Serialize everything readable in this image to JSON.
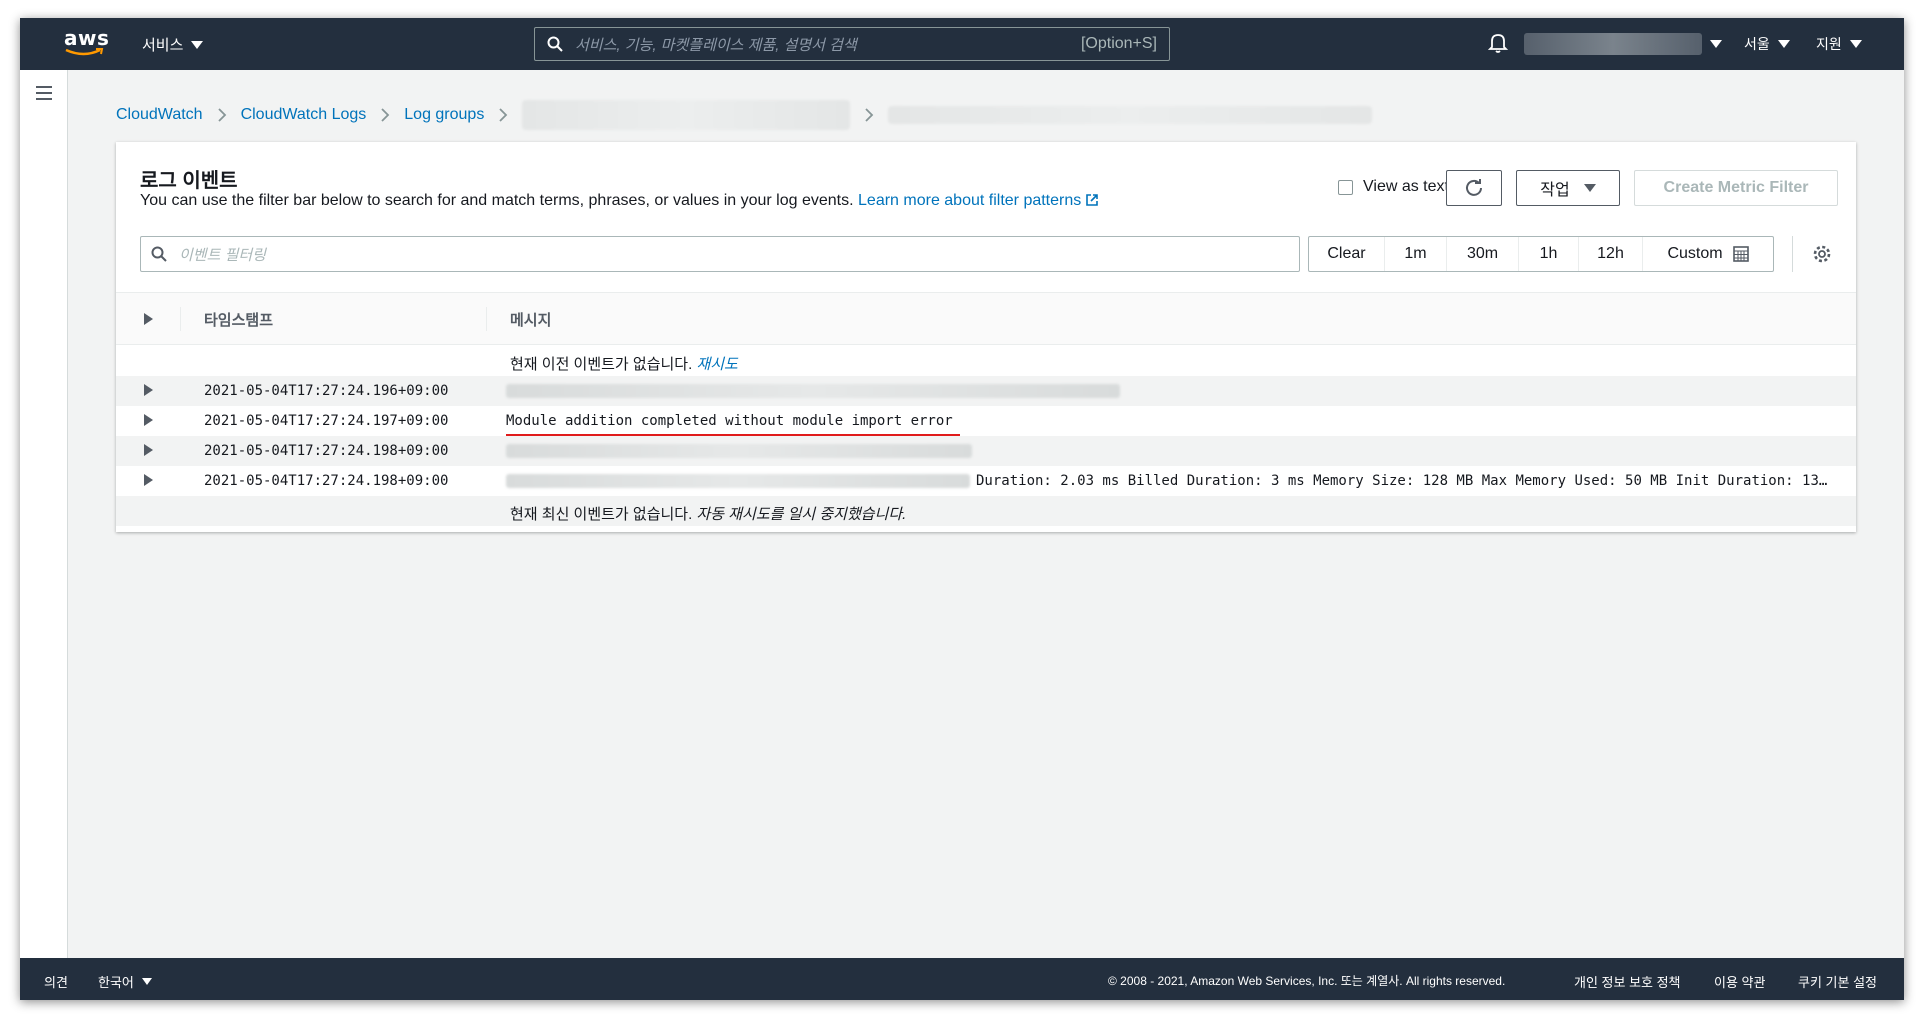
{
  "nav": {
    "logo_text": "aws",
    "services": "서비스",
    "search_placeholder": "서비스, 기능, 마켓플레이스 제품, 설명서 검색",
    "search_shortcut": "[Option+S]",
    "region": "서울",
    "support": "지원"
  },
  "breadcrumb": {
    "items": [
      "CloudWatch",
      "CloudWatch Logs",
      "Log groups"
    ]
  },
  "panel": {
    "title": "로그 이벤트",
    "description": "You can use the filter bar below to search for and match terms, phrases, or values in your log events.",
    "learn_more": "Learn more about filter patterns",
    "view_as_text": "View as text",
    "actions": "작업",
    "create_metric_filter": "Create Metric Filter",
    "filter_placeholder": "이벤트 필터링",
    "time_ranges": [
      "Clear",
      "1m",
      "30m",
      "1h",
      "12h",
      "Custom"
    ]
  },
  "table": {
    "col_timestamp": "타임스탬프",
    "col_message": "메시지",
    "top_notice": "현재 이전 이벤트가 없습니다.",
    "top_retry": "재시도",
    "rows": [
      {
        "timestamp": "2021-05-04T17:27:24.196+09:00",
        "message": ""
      },
      {
        "timestamp": "2021-05-04T17:27:24.197+09:00",
        "message": "Module addition completed without module import error"
      },
      {
        "timestamp": "2021-05-04T17:27:24.198+09:00",
        "message": ""
      },
      {
        "timestamp": "2021-05-04T17:27:24.198+09:00",
        "message": "Duration: 2.03 ms Billed Duration: 3 ms Memory Size: 128 MB Max Memory Used: 50 MB Init Duration: 13…"
      }
    ],
    "bottom_notice": "현재 최신 이벤트가 없습니다.",
    "bottom_notice_italic": "자동 재시도를 일시 중지했습니다."
  },
  "footer": {
    "feedback": "의견",
    "language": "한국어",
    "copyright": "© 2008 - 2021, Amazon Web Services, Inc. 또는 계열사. All rights reserved.",
    "privacy": "개인 정보 보호 정책",
    "terms": "이용 약관",
    "cookies": "쿠키 기본 설정"
  },
  "colors": {
    "nav_bg": "#232f3e",
    "link": "#0073bb",
    "highlight_underline": "#e01b1b"
  }
}
